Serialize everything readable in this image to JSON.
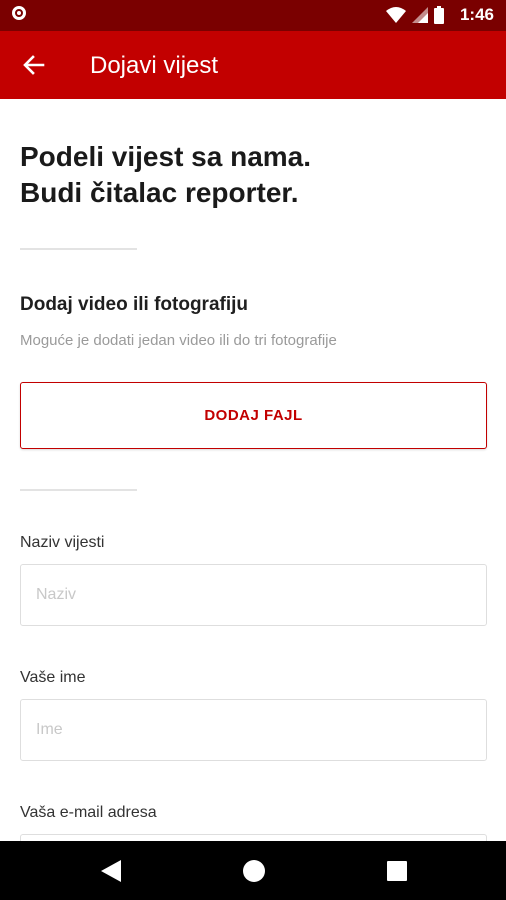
{
  "status_bar": {
    "time": "1:46",
    "icons": [
      "record-icon",
      "wifi-icon",
      "signal-icon",
      "battery-icon"
    ]
  },
  "app_bar": {
    "title": "Dojavi vijest",
    "back_icon": "arrow-left-icon"
  },
  "intro": {
    "line1": "Podeli vijest sa nama.",
    "line2": "Budi čitalac reporter."
  },
  "media": {
    "title": "Dodaj video ili fotografiju",
    "subtitle": "Moguće je dodati jedan video ili do tri fotografije",
    "button_label": "DODAJ FAJL"
  },
  "form": {
    "news_title": {
      "label": "Naziv vijesti",
      "placeholder": "Naziv",
      "value": ""
    },
    "name": {
      "label": "Vaše ime",
      "placeholder": "Ime",
      "value": ""
    },
    "email": {
      "label": "Vaša e-mail adresa",
      "placeholder": "",
      "value": ""
    }
  },
  "nav_bar": {
    "buttons": [
      "back-triangle-icon",
      "home-circle-icon",
      "recents-square-icon"
    ]
  },
  "colors": {
    "primary": "#c20000",
    "status_bar": "#7a0000",
    "nav_bar": "#000000"
  }
}
